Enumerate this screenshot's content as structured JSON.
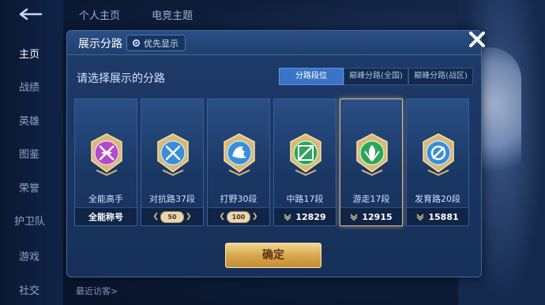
{
  "background": {
    "top_tabs": [
      "个人主页",
      "电竞主题"
    ],
    "sidebar": [
      "主页",
      "战绩",
      "英雄",
      "图鉴",
      "荣誉",
      "护卫队",
      "游戏",
      "社交"
    ],
    "footer_text": "最近访客>"
  },
  "dialog": {
    "title": "展示分路",
    "priority_label": "优先显示",
    "prompt": "请选择展示的分路",
    "filters": [
      {
        "label": "分路段位",
        "active": true
      },
      {
        "label": "巅峰分路(全国)",
        "active": false
      },
      {
        "label": "巅峰分路(战区)",
        "active": false
      }
    ],
    "cards": [
      {
        "label": "全能高手",
        "footer": "全能称号",
        "footer_type": "text",
        "color": "#b14cc9",
        "selected": false
      },
      {
        "label": "对抗路37段",
        "footer": "50",
        "footer_type": "badge",
        "color": "#3a8ed6",
        "selected": false
      },
      {
        "label": "打野30段",
        "footer": "100",
        "footer_type": "badge",
        "color": "#3a8ed6",
        "selected": false
      },
      {
        "label": "中路17段",
        "footer": "12829",
        "footer_type": "score",
        "color": "#2fa35a",
        "selected": false
      },
      {
        "label": "游走17段",
        "footer": "12915",
        "footer_type": "score",
        "color": "#2fa35a",
        "selected": true
      },
      {
        "label": "发育路20段",
        "footer": "15881",
        "footer_type": "score",
        "color": "#3a8ed6",
        "selected": false
      }
    ],
    "confirm_label": "确定"
  },
  "colors": {
    "accent_gold": "#d9a74e",
    "filter_active": "#3a74c6",
    "selected_border": "#e2b98a"
  }
}
